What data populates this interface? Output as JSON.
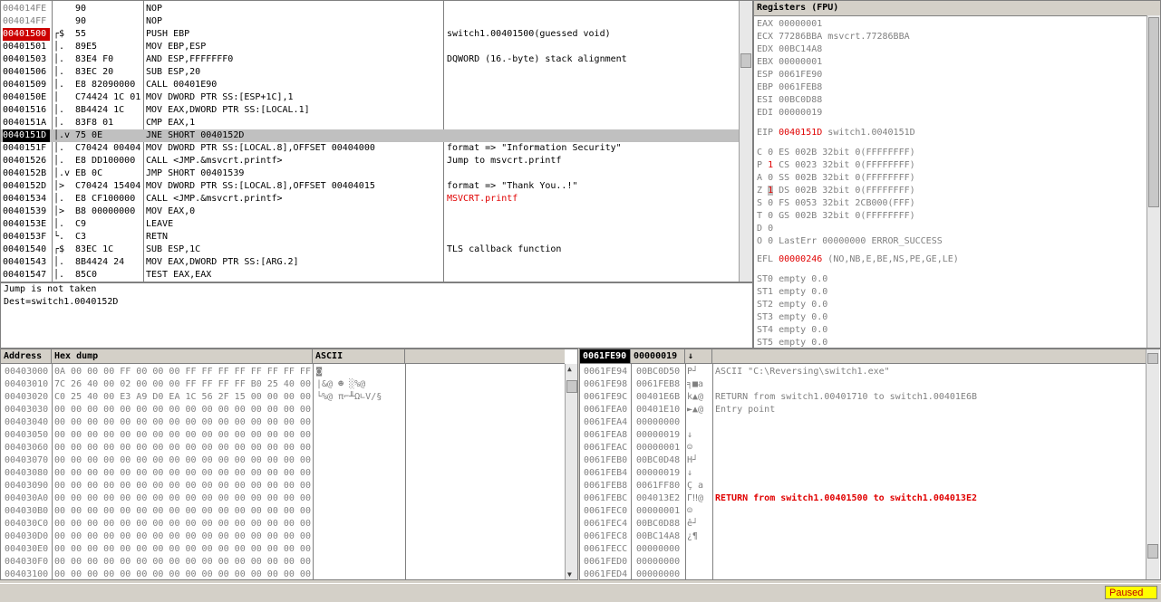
{
  "disasm": {
    "rows": [
      {
        "addr": "004014FE",
        "mark": "",
        "hex": "90",
        "instr": "NOP",
        "comment": "",
        "style": "gray"
      },
      {
        "addr": "004014FF",
        "mark": "",
        "hex": "90",
        "instr": "NOP",
        "comment": "",
        "style": "gray"
      },
      {
        "addr": "00401500",
        "mark": "┌$",
        "hex": "55",
        "instr": "PUSH EBP",
        "comment": "switch1.00401500(guessed void)",
        "style": "bp"
      },
      {
        "addr": "00401501",
        "mark": "│.",
        "hex": "89E5",
        "instr": "MOV EBP,ESP",
        "comment": "",
        "style": ""
      },
      {
        "addr": "00401503",
        "mark": "│.",
        "hex": "83E4 F0",
        "instr": "AND ESP,FFFFFFF0",
        "comment": "DQWORD (16.-byte) stack alignment",
        "style": ""
      },
      {
        "addr": "00401506",
        "mark": "│.",
        "hex": "83EC 20",
        "instr": "SUB ESP,20",
        "comment": "",
        "style": ""
      },
      {
        "addr": "00401509",
        "mark": "│.",
        "hex": "E8 82090000",
        "instr": "CALL 00401E90",
        "comment": "",
        "style": ""
      },
      {
        "addr": "0040150E",
        "mark": "│",
        "hex": "C74424 1C 01(",
        "instr": "MOV DWORD PTR SS:[ESP+1C],1",
        "comment": "",
        "style": ""
      },
      {
        "addr": "00401516",
        "mark": "│.",
        "hex": "8B4424 1C",
        "instr": "MOV EAX,DWORD PTR SS:[LOCAL.1]",
        "comment": "",
        "style": ""
      },
      {
        "addr": "0040151A",
        "mark": "│.",
        "hex": "83F8 01",
        "instr": "CMP EAX,1",
        "comment": "",
        "style": ""
      },
      {
        "addr": "0040151D",
        "mark": "│.v",
        "hex": "75 0E",
        "instr": "JNE SHORT 0040152D",
        "comment": "",
        "style": "eip"
      },
      {
        "addr": "0040151F",
        "mark": "│.",
        "hex": "C70424 00404(",
        "instr": "MOV DWORD PTR SS:[LOCAL.8],OFFSET 00404000",
        "comment": "format => \"Information Security\"",
        "style": ""
      },
      {
        "addr": "00401526",
        "mark": "│.",
        "hex": "E8 DD100000",
        "instr": "CALL <JMP.&msvcrt.printf>",
        "comment": "Jump to msvcrt.printf",
        "style": ""
      },
      {
        "addr": "0040152B",
        "mark": "│.v",
        "hex": "EB 0C",
        "instr": "JMP SHORT 00401539",
        "comment": "",
        "style": ""
      },
      {
        "addr": "0040152D",
        "mark": "│>",
        "hex": "C70424 15404(",
        "instr": "MOV DWORD PTR SS:[LOCAL.8],OFFSET 00404015",
        "comment": "format => \"Thank You..!\"",
        "style": ""
      },
      {
        "addr": "00401534",
        "mark": "│.",
        "hex": "E8 CF100000",
        "instr": "CALL <JMP.&msvcrt.printf>",
        "comment": "MSVCRT.printf",
        "style": "redcomment"
      },
      {
        "addr": "00401539",
        "mark": "│>",
        "hex": "B8 00000000",
        "instr": "MOV EAX,0",
        "comment": "",
        "style": ""
      },
      {
        "addr": "0040153E",
        "mark": "│.",
        "hex": "C9",
        "instr": "LEAVE",
        "comment": "",
        "style": ""
      },
      {
        "addr": "0040153F",
        "mark": "└.",
        "hex": "C3",
        "instr": "RETN",
        "comment": "",
        "style": ""
      },
      {
        "addr": "00401540",
        "mark": "┌$",
        "hex": "83EC 1C",
        "instr": "SUB ESP,1C",
        "comment": "TLS callback function",
        "style": ""
      },
      {
        "addr": "00401543",
        "mark": "│.",
        "hex": "8B4424 24",
        "instr": "MOV EAX,DWORD PTR SS:[ARG.2]",
        "comment": "",
        "style": ""
      },
      {
        "addr": "00401547",
        "mark": "│.",
        "hex": "85C0",
        "instr": "TEST EAX,EAX",
        "comment": "",
        "style": ""
      }
    ]
  },
  "info": {
    "lines": [
      "Jump is not taken",
      "Dest=switch1.0040152D"
    ]
  },
  "registers": {
    "title": "Registers (FPU)",
    "gp": [
      {
        "name": "EAX",
        "value": "00000001",
        "extra": ""
      },
      {
        "name": "ECX",
        "value": "77286BBA",
        "extra": "msvcrt.77286BBA"
      },
      {
        "name": "EDX",
        "value": "00BC14A8",
        "extra": ""
      },
      {
        "name": "EBX",
        "value": "00000001",
        "extra": ""
      },
      {
        "name": "ESP",
        "value": "0061FE90",
        "extra": ""
      },
      {
        "name": "EBP",
        "value": "0061FEB8",
        "extra": ""
      },
      {
        "name": "ESI",
        "value": "00BC0D88",
        "extra": ""
      },
      {
        "name": "EDI",
        "value": "00000019",
        "extra": ""
      }
    ],
    "eip": {
      "name": "EIP",
      "value": "0040151D",
      "extra": "switch1.0040151D"
    },
    "flags": [
      {
        "f": "C",
        "v": "0",
        "seg": "ES 002B 32bit 0(FFFFFFFF)",
        "changed": false
      },
      {
        "f": "P",
        "v": "1",
        "seg": "CS 0023 32bit 0(FFFFFFFF)",
        "changed": true
      },
      {
        "f": "A",
        "v": "0",
        "seg": "SS 002B 32bit 0(FFFFFFFF)",
        "changed": false
      },
      {
        "f": "Z",
        "v": "1",
        "seg": "DS 002B 32bit 0(FFFFFFFF)",
        "changed": true
      },
      {
        "f": "S",
        "v": "0",
        "seg": "FS 0053 32bit 2CB000(FFF)",
        "changed": false
      },
      {
        "f": "T",
        "v": "0",
        "seg": "GS 002B 32bit 0(FFFFFFFF)",
        "changed": false
      },
      {
        "f": "D",
        "v": "0",
        "seg": "",
        "changed": false
      },
      {
        "f": "O",
        "v": "0",
        "seg": "LastErr 00000000 ERROR_SUCCESS",
        "changed": false
      }
    ],
    "efl": {
      "name": "EFL",
      "value": "00000246",
      "extra": "(NO,NB,E,BE,NS,PE,GE,LE)"
    },
    "fpu": [
      "ST0 empty 0.0",
      "ST1 empty 0.0",
      "ST2 empty 0.0",
      "ST3 empty 0.0",
      "ST4 empty 0.0",
      "ST5 empty 0.0"
    ]
  },
  "dump": {
    "headers": {
      "address": "Address",
      "hex": "Hex dump",
      "ascii": "ASCII"
    },
    "rows": [
      {
        "addr": "00403000",
        "hex": "0A 00 00 00 FF 00 00 00 FF FF FF FF FF FF FF FF",
        "ascii": "◙"
      },
      {
        "addr": "00403010",
        "hex": "7C 26 40 00 02 00 00 00 FF FF FF FF B0 25 40 00",
        "ascii": "|&@ ☻       ░%@"
      },
      {
        "addr": "00403020",
        "hex": "C0 25 40 00 E3 A9 D0 EA 1C 56 2F 15 00 00 00 00",
        "ascii": "└%@ π⌐╨Ω∟V/§"
      },
      {
        "addr": "00403030",
        "hex": "00 00 00 00 00 00 00 00 00 00 00 00 00 00 00 00",
        "ascii": ""
      },
      {
        "addr": "00403040",
        "hex": "00 00 00 00 00 00 00 00 00 00 00 00 00 00 00 00",
        "ascii": ""
      },
      {
        "addr": "00403050",
        "hex": "00 00 00 00 00 00 00 00 00 00 00 00 00 00 00 00",
        "ascii": ""
      },
      {
        "addr": "00403060",
        "hex": "00 00 00 00 00 00 00 00 00 00 00 00 00 00 00 00",
        "ascii": ""
      },
      {
        "addr": "00403070",
        "hex": "00 00 00 00 00 00 00 00 00 00 00 00 00 00 00 00",
        "ascii": ""
      },
      {
        "addr": "00403080",
        "hex": "00 00 00 00 00 00 00 00 00 00 00 00 00 00 00 00",
        "ascii": ""
      },
      {
        "addr": "00403090",
        "hex": "00 00 00 00 00 00 00 00 00 00 00 00 00 00 00 00",
        "ascii": ""
      },
      {
        "addr": "004030A0",
        "hex": "00 00 00 00 00 00 00 00 00 00 00 00 00 00 00 00",
        "ascii": ""
      },
      {
        "addr": "004030B0",
        "hex": "00 00 00 00 00 00 00 00 00 00 00 00 00 00 00 00",
        "ascii": ""
      },
      {
        "addr": "004030C0",
        "hex": "00 00 00 00 00 00 00 00 00 00 00 00 00 00 00 00",
        "ascii": ""
      },
      {
        "addr": "004030D0",
        "hex": "00 00 00 00 00 00 00 00 00 00 00 00 00 00 00 00",
        "ascii": ""
      },
      {
        "addr": "004030E0",
        "hex": "00 00 00 00 00 00 00 00 00 00 00 00 00 00 00 00",
        "ascii": ""
      },
      {
        "addr": "004030F0",
        "hex": "00 00 00 00 00 00 00 00 00 00 00 00 00 00 00 00",
        "ascii": ""
      },
      {
        "addr": "00403100",
        "hex": "00 00 00 00 00 00 00 00 00 00 00 00 00 00 00 00",
        "ascii": ""
      }
    ]
  },
  "stack": {
    "headers": {
      "addr": "0061FE90",
      "value": "00000019",
      "ascii": "↓"
    },
    "rows": [
      {
        "addr": "0061FE94",
        "value": "00BC0D50",
        "ascii": "P┘",
        "comment": "ASCII \"C:\\Reversing\\switch1.exe\"",
        "red": false
      },
      {
        "addr": "0061FE98",
        "value": "0061FEB8",
        "ascii": "╕■a",
        "comment": "",
        "red": false
      },
      {
        "addr": "0061FE9C",
        "value": "00401E6B",
        "ascii": "k▲@",
        "comment": "RETURN from switch1.00401710 to switch1.00401E6B",
        "red": false
      },
      {
        "addr": "0061FEA0",
        "value": "00401E10",
        "ascii": "►▲@",
        "comment": "Entry point",
        "red": false
      },
      {
        "addr": "0061FEA4",
        "value": "00000000",
        "ascii": "",
        "comment": "",
        "red": false
      },
      {
        "addr": "0061FEA8",
        "value": "00000019",
        "ascii": "↓",
        "comment": "",
        "red": false
      },
      {
        "addr": "0061FEAC",
        "value": "00000001",
        "ascii": "☺",
        "comment": "",
        "red": false
      },
      {
        "addr": "0061FEB0",
        "value": "00BC0D48",
        "ascii": "H┘",
        "comment": "",
        "red": false
      },
      {
        "addr": "0061FEB4",
        "value": "00000019",
        "ascii": "↓",
        "comment": "",
        "red": false
      },
      {
        "addr": "0061FEB8",
        "value": "0061FF80",
        "ascii": "Ç a",
        "comment": "",
        "red": false
      },
      {
        "addr": "0061FEBC",
        "value": "004013E2",
        "ascii": "Γ‼@",
        "comment": "RETURN from switch1.00401500 to switch1.004013E2",
        "red": true
      },
      {
        "addr": "0061FEC0",
        "value": "00000001",
        "ascii": "☺",
        "comment": "",
        "red": false
      },
      {
        "addr": "0061FEC4",
        "value": "00BC0D88",
        "ascii": "ê┘",
        "comment": "",
        "red": false
      },
      {
        "addr": "0061FEC8",
        "value": "00BC14A8",
        "ascii": "¿¶",
        "comment": "",
        "red": false
      },
      {
        "addr": "0061FECC",
        "value": "00000000",
        "ascii": "",
        "comment": "",
        "red": false
      },
      {
        "addr": "0061FED0",
        "value": "00000000",
        "ascii": "",
        "comment": "",
        "red": false
      },
      {
        "addr": "0061FED4",
        "value": "00000000",
        "ascii": "",
        "comment": "",
        "red": false
      }
    ]
  },
  "status": {
    "text": "Paused"
  },
  "icons": {
    "scroll_up": "▲",
    "scroll_down": "▼"
  }
}
